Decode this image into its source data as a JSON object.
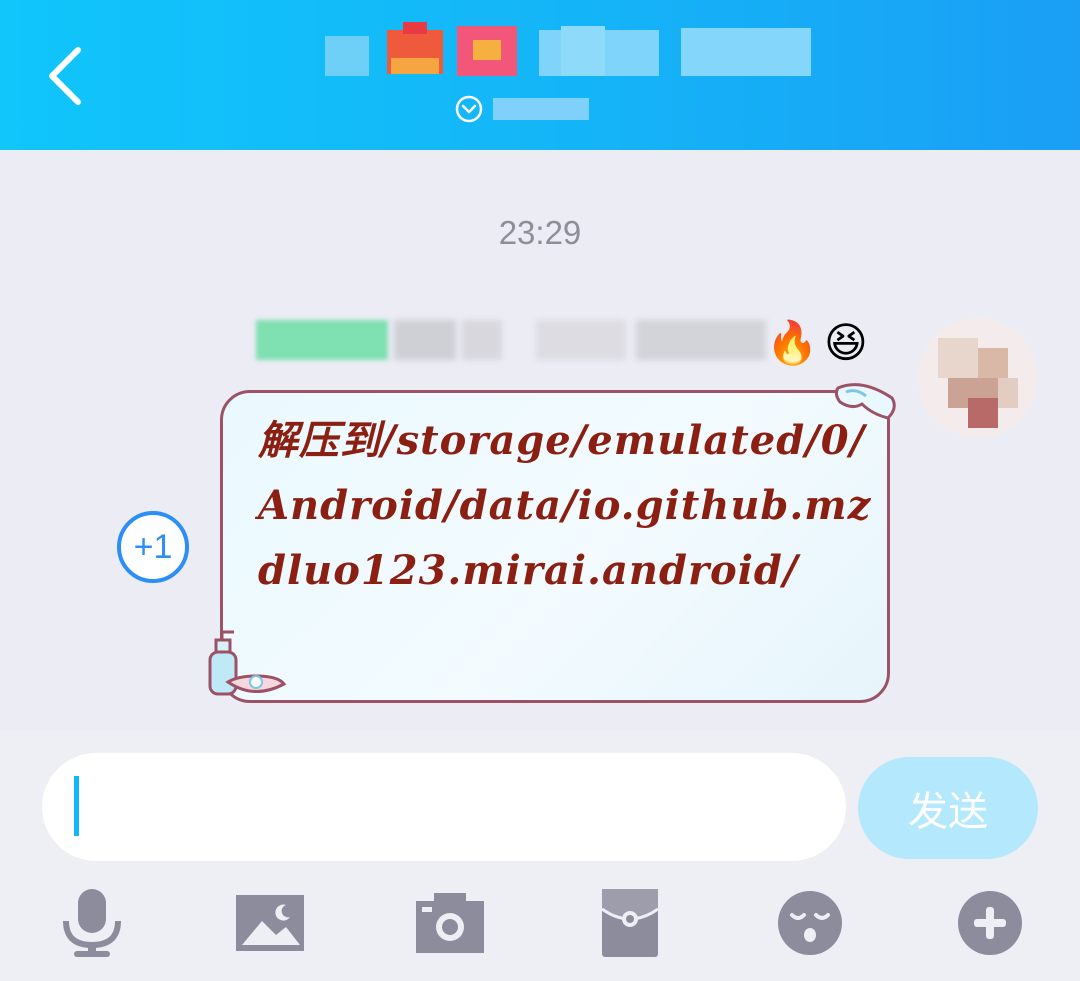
{
  "header": {
    "back_icon": "chevron-left-icon",
    "chat_title": "",
    "chat_subtitle": "",
    "colors": {
      "gradient_start": "#10c6fb",
      "gradient_end": "#1a9ff5"
    }
  },
  "chat": {
    "timestamp": "23:29",
    "message": {
      "sender_emojis": [
        "🔥",
        "😆"
      ],
      "plus_one_label": "+1",
      "text": "解压到/storage/emulated/0/Android/data/io.github.mzdluo123.mirai.android/",
      "colors": {
        "text": "#8a1f12",
        "border": "#9c5266"
      }
    }
  },
  "input": {
    "value": "",
    "send_label": "发送",
    "colors": {
      "send_bg": "#b4e8fc",
      "caret": "#10b8f8"
    }
  },
  "toolbar": {
    "icons": [
      "microphone-icon",
      "image-icon",
      "camera-icon",
      "red-packet-icon",
      "emoji-icon",
      "plus-icon"
    ],
    "color": "#8c8c9c"
  }
}
